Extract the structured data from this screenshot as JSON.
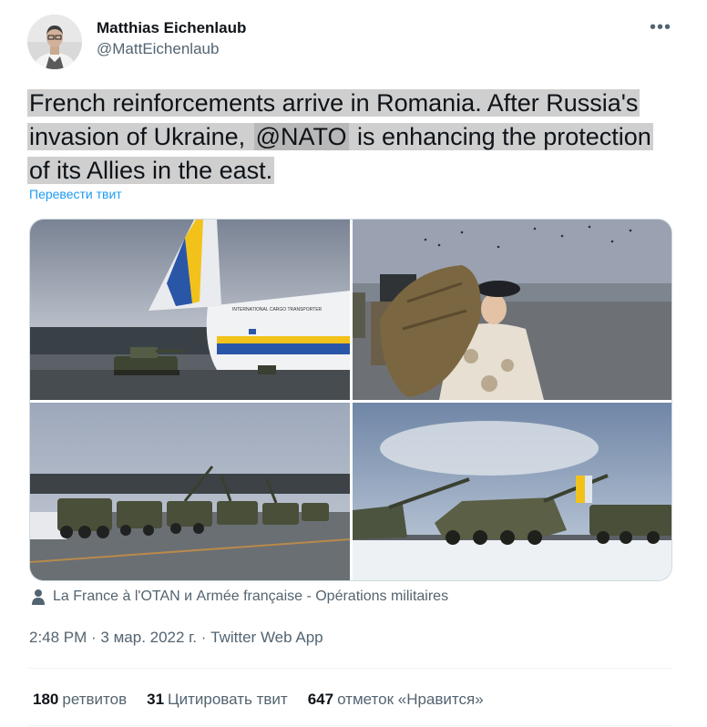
{
  "author": {
    "name": "Matthias Eichenlaub",
    "handle": "@MattEichenlaub"
  },
  "tweet": {
    "text_part1": "French reinforcements arrive in Romania. After Russia's invasion of Ukraine, ",
    "mention": "@NATO",
    "text_part2": " is enhancing the protection of its Allies in the east.",
    "translate_label": "Перевести твит"
  },
  "media": {
    "photo1_alt": "Cargo plane unloading armored vehicle",
    "photo2_alt": "Soldier carrying duffel bag",
    "photo3_alt": "Line of armored vehicles on tarmac",
    "photo4_alt": "Tanks on snowy field",
    "plane_lettering": "INTERNATIONAL CARGO TRANSPORTER",
    "tagged_users": "La France à l'OTAN и Armée française - Opérations militaires"
  },
  "meta": {
    "time": "2:48 PM",
    "date": "3 мар. 2022 г.",
    "source": "Twitter Web App",
    "sep": " · "
  },
  "stats": {
    "retweets_count": "180",
    "retweets_label": "ретвитов",
    "quotes_count": "31",
    "quotes_label": "Цитировать твит",
    "likes_count": "647",
    "likes_label": "отметок «Нравится»"
  },
  "colors": {
    "accent": "#1d9bf0",
    "secondary_text": "#536471",
    "highlight": "#cfcfcf"
  },
  "icons": {
    "more": "more-dots-icon",
    "tagged": "person-icon"
  }
}
